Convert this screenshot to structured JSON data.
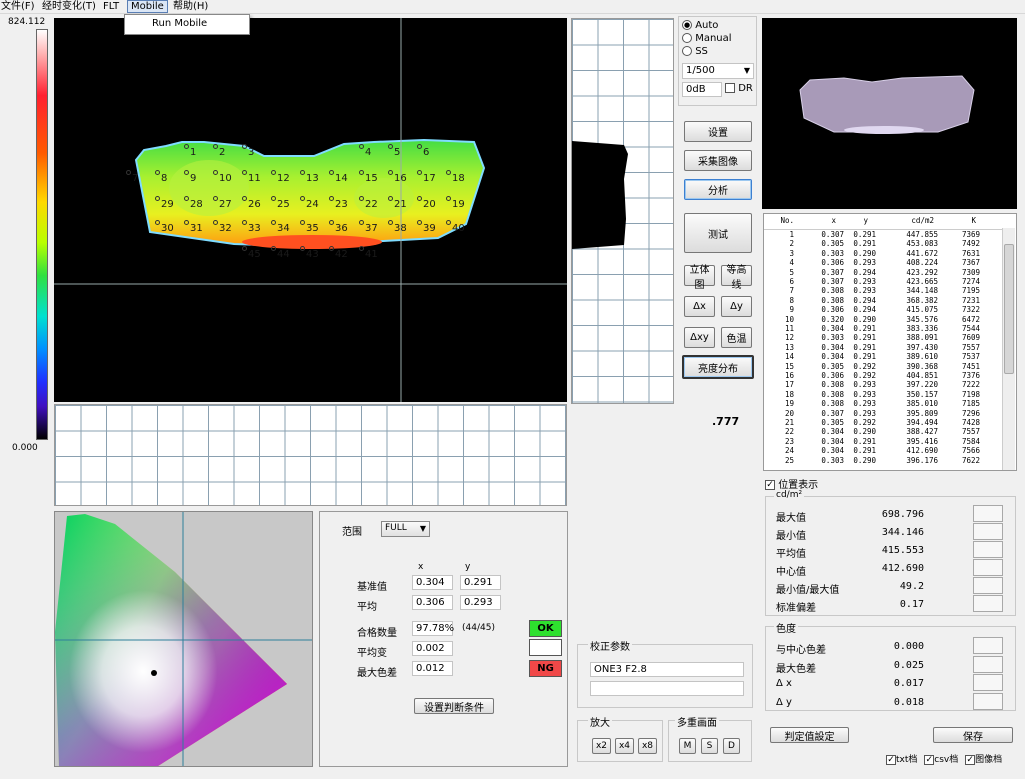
{
  "menu": {
    "items": [
      "文件(F)",
      "经时变化(T)",
      "FLT",
      "Mobile",
      "帮助(H)"
    ],
    "popup_item": "Run Mobile"
  },
  "colorbar": {
    "max": "824.112",
    "min": "0.000"
  },
  "heatmap": {
    "point_labels": [
      "1",
      "2",
      "3",
      "4",
      "5",
      "6",
      "7",
      "8",
      "9",
      "10",
      "11",
      "12",
      "13",
      "14",
      "15",
      "16",
      "17",
      "18",
      "19",
      "20",
      "21",
      "22",
      "23",
      "24",
      "25",
      "26",
      "27",
      "28",
      "29",
      "30",
      "31",
      "32",
      "33",
      "34",
      "35",
      "36",
      "37",
      "38",
      "39",
      "40",
      "41",
      "42",
      "43",
      "44",
      "45"
    ]
  },
  "side_value": ".777",
  "exposure": {
    "options": [
      "Auto",
      "Manual",
      "SS"
    ],
    "selected": "Auto",
    "shutter": "1/500",
    "gain": "0dB",
    "dr_label": "DR"
  },
  "buttons": {
    "settings": "设置",
    "capture": "采集图像",
    "analyze": "分析",
    "measure": "测试",
    "stereo": "立体图",
    "contour": "等高线",
    "dx": "Δx",
    "dy": "Δy",
    "dxy": "Δxy",
    "color_temp": "色温",
    "luminance": "亮度分布",
    "set_criteria": "设置判断条件",
    "judge_settings": "判定值設定",
    "save": "保存",
    "x2": "x2",
    "x4": "x4",
    "x8": "x8",
    "m": "M",
    "s": "S",
    "d": "D"
  },
  "table": {
    "headers": [
      "No.",
      "x",
      "y",
      "cd/m2",
      "K"
    ],
    "rows": [
      [
        "1",
        "0.307",
        "0.291",
        "447.855",
        "7369"
      ],
      [
        "2",
        "0.305",
        "0.291",
        "453.083",
        "7492"
      ],
      [
        "3",
        "0.303",
        "0.290",
        "441.672",
        "7631"
      ],
      [
        "4",
        "0.306",
        "0.293",
        "408.224",
        "7367"
      ],
      [
        "5",
        "0.307",
        "0.294",
        "423.292",
        "7309"
      ],
      [
        "6",
        "0.307",
        "0.293",
        "423.665",
        "7274"
      ],
      [
        "7",
        "0.308",
        "0.293",
        "344.148",
        "7195"
      ],
      [
        "8",
        "0.308",
        "0.294",
        "368.382",
        "7231"
      ],
      [
        "9",
        "0.306",
        "0.294",
        "415.075",
        "7322"
      ],
      [
        "10",
        "0.320",
        "0.290",
        "345.576",
        "6472"
      ],
      [
        "11",
        "0.304",
        "0.291",
        "383.336",
        "7544"
      ],
      [
        "12",
        "0.303",
        "0.291",
        "388.091",
        "7609"
      ],
      [
        "13",
        "0.304",
        "0.291",
        "397.430",
        "7557"
      ],
      [
        "14",
        "0.304",
        "0.291",
        "389.610",
        "7537"
      ],
      [
        "15",
        "0.305",
        "0.292",
        "390.368",
        "7451"
      ],
      [
        "16",
        "0.306",
        "0.292",
        "404.851",
        "7376"
      ],
      [
        "17",
        "0.308",
        "0.293",
        "397.220",
        "7222"
      ],
      [
        "18",
        "0.308",
        "0.293",
        "350.157",
        "7198"
      ],
      [
        "19",
        "0.308",
        "0.293",
        "385.010",
        "7185"
      ],
      [
        "20",
        "0.307",
        "0.293",
        "395.809",
        "7296"
      ],
      [
        "21",
        "0.305",
        "0.292",
        "394.494",
        "7428"
      ],
      [
        "22",
        "0.304",
        "0.290",
        "388.427",
        "7557"
      ],
      [
        "23",
        "0.304",
        "0.291",
        "395.416",
        "7584"
      ],
      [
        "24",
        "0.304",
        "0.291",
        "412.690",
        "7566"
      ],
      [
        "25",
        "0.303",
        "0.290",
        "396.176",
        "7622"
      ]
    ]
  },
  "position_display": "位置表示",
  "luminance_stats": {
    "unit": "cd/m²",
    "rows": [
      {
        "label": "最大值",
        "value": "698.796"
      },
      {
        "label": "最小值",
        "value": "344.146"
      },
      {
        "label": "平均值",
        "value": "415.553"
      },
      {
        "label": "中心值",
        "value": "412.690"
      },
      {
        "label": "最小值/最大值",
        "value": "49.2"
      },
      {
        "label": "标准偏差",
        "value": "0.17"
      }
    ]
  },
  "chroma_stats": {
    "title": "色度",
    "rows": [
      {
        "label": "与中心色差",
        "value": "0.000"
      },
      {
        "label": "最大色差",
        "value": "0.025"
      },
      {
        "label": "Δ x",
        "value": "0.017"
      },
      {
        "label": "Δ y",
        "value": "0.018"
      }
    ]
  },
  "files": [
    "txt档",
    "csv档",
    "图像档"
  ],
  "judge": {
    "range_label": "范围",
    "range_value": "FULL",
    "col_x": "x",
    "col_y": "y",
    "ref_label": "基准值",
    "ref_x": "0.304",
    "ref_y": "0.291",
    "avg_label": "平均",
    "avg_x": "0.306",
    "avg_y": "0.293",
    "pass_label": "合格数量",
    "pass_pct": "97.78%",
    "pass_count": "(44/45)",
    "ok": "OK",
    "var_label": "平均变",
    "var_value": "0.002",
    "maxdiff_label": "最大色差",
    "maxdiff_value": "0.012",
    "ng": "NG"
  },
  "calib": {
    "title": "校正参数",
    "value": "ONE3 F2.8",
    "zoom_title": "放大",
    "multi_title": "多重画面"
  },
  "colors": {
    "ok": "#2ee02e",
    "ng": "#f04848",
    "accent": "#4a8fd8"
  }
}
